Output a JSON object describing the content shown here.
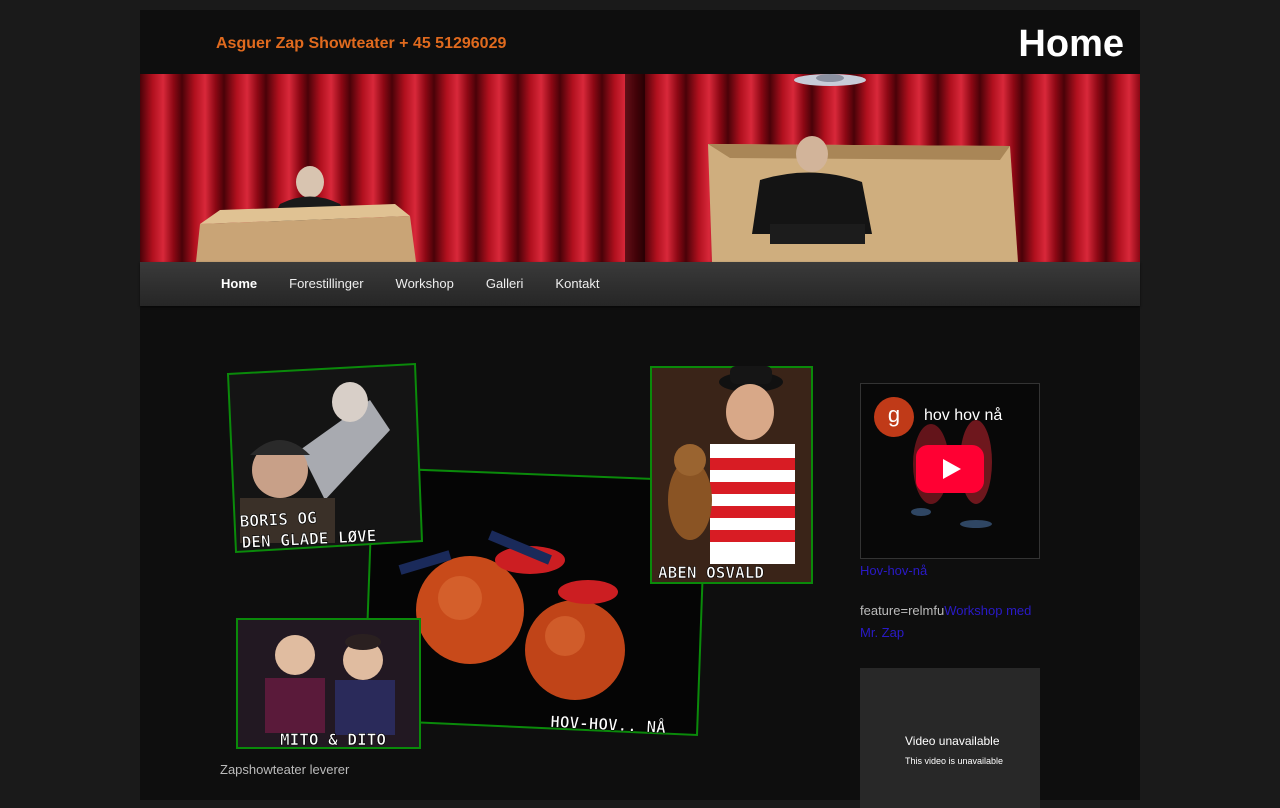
{
  "header": {
    "site_title": "Asguer Zap Showteater + 45 51296029",
    "page_title": "Home"
  },
  "nav": {
    "items": [
      {
        "label": "Home",
        "current": true
      },
      {
        "label": "Forestillinger",
        "current": false
      },
      {
        "label": "Workshop",
        "current": false
      },
      {
        "label": "Galleri",
        "current": false
      },
      {
        "label": "Kontakt",
        "current": false
      }
    ]
  },
  "collage": {
    "captions": {
      "boris_1": "BORIS OG",
      "boris_2": "DEN GLADE LØVE",
      "aben": "ABEN OSVALD",
      "hov": "HOV-HOV.. NÅ",
      "mito": "MITO & DITO"
    }
  },
  "content": {
    "intro_text": "Zapshowteater leverer"
  },
  "sidebar": {
    "video1": {
      "channel_initial": "g",
      "title": "hov hov nå"
    },
    "link_hov": "Hov-hov-nå",
    "feature_prefix": "feature=relmfu",
    "link_workshop": "Workshop med Mr. Zap",
    "video2": {
      "title": "Video unavailable",
      "subtitle": "This video is unavailable"
    }
  },
  "colors": {
    "accent_orange": "#e06a1e",
    "link_blue": "#2a1ac8",
    "youtube_red": "#ff0033",
    "collage_border_green": "#0a8a0a"
  }
}
